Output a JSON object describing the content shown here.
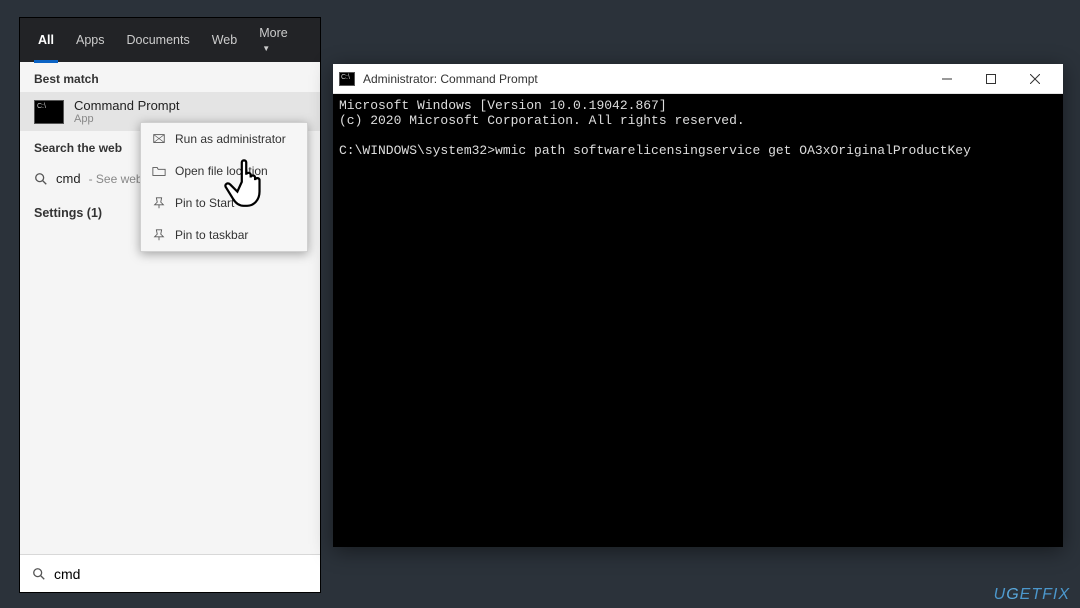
{
  "search_panel": {
    "tabs": {
      "all": "All",
      "apps": "Apps",
      "documents": "Documents",
      "web": "Web",
      "more": "More"
    },
    "best_match_label": "Best match",
    "result": {
      "title": "Command Prompt",
      "subtitle": "App"
    },
    "search_web_label": "Search the web",
    "web_row": {
      "query": "cmd",
      "suffix": " - See web"
    },
    "settings_label": "Settings (1)",
    "context_menu": {
      "run_admin": "Run as administrator",
      "open_loc": "Open file location",
      "pin_start": "Pin to Start",
      "pin_taskbar": "Pin to taskbar"
    },
    "input_value": "cmd"
  },
  "cmd_window": {
    "title": "Administrator: Command Prompt",
    "line1": "Microsoft Windows [Version 10.0.19042.867]",
    "line2": "(c) 2020 Microsoft Corporation. All rights reserved.",
    "prompt": "C:\\WINDOWS\\system32>",
    "command": "wmic path softwarelicensingservice get OA3xOriginalProductKey"
  },
  "watermark": "UGETFIX"
}
